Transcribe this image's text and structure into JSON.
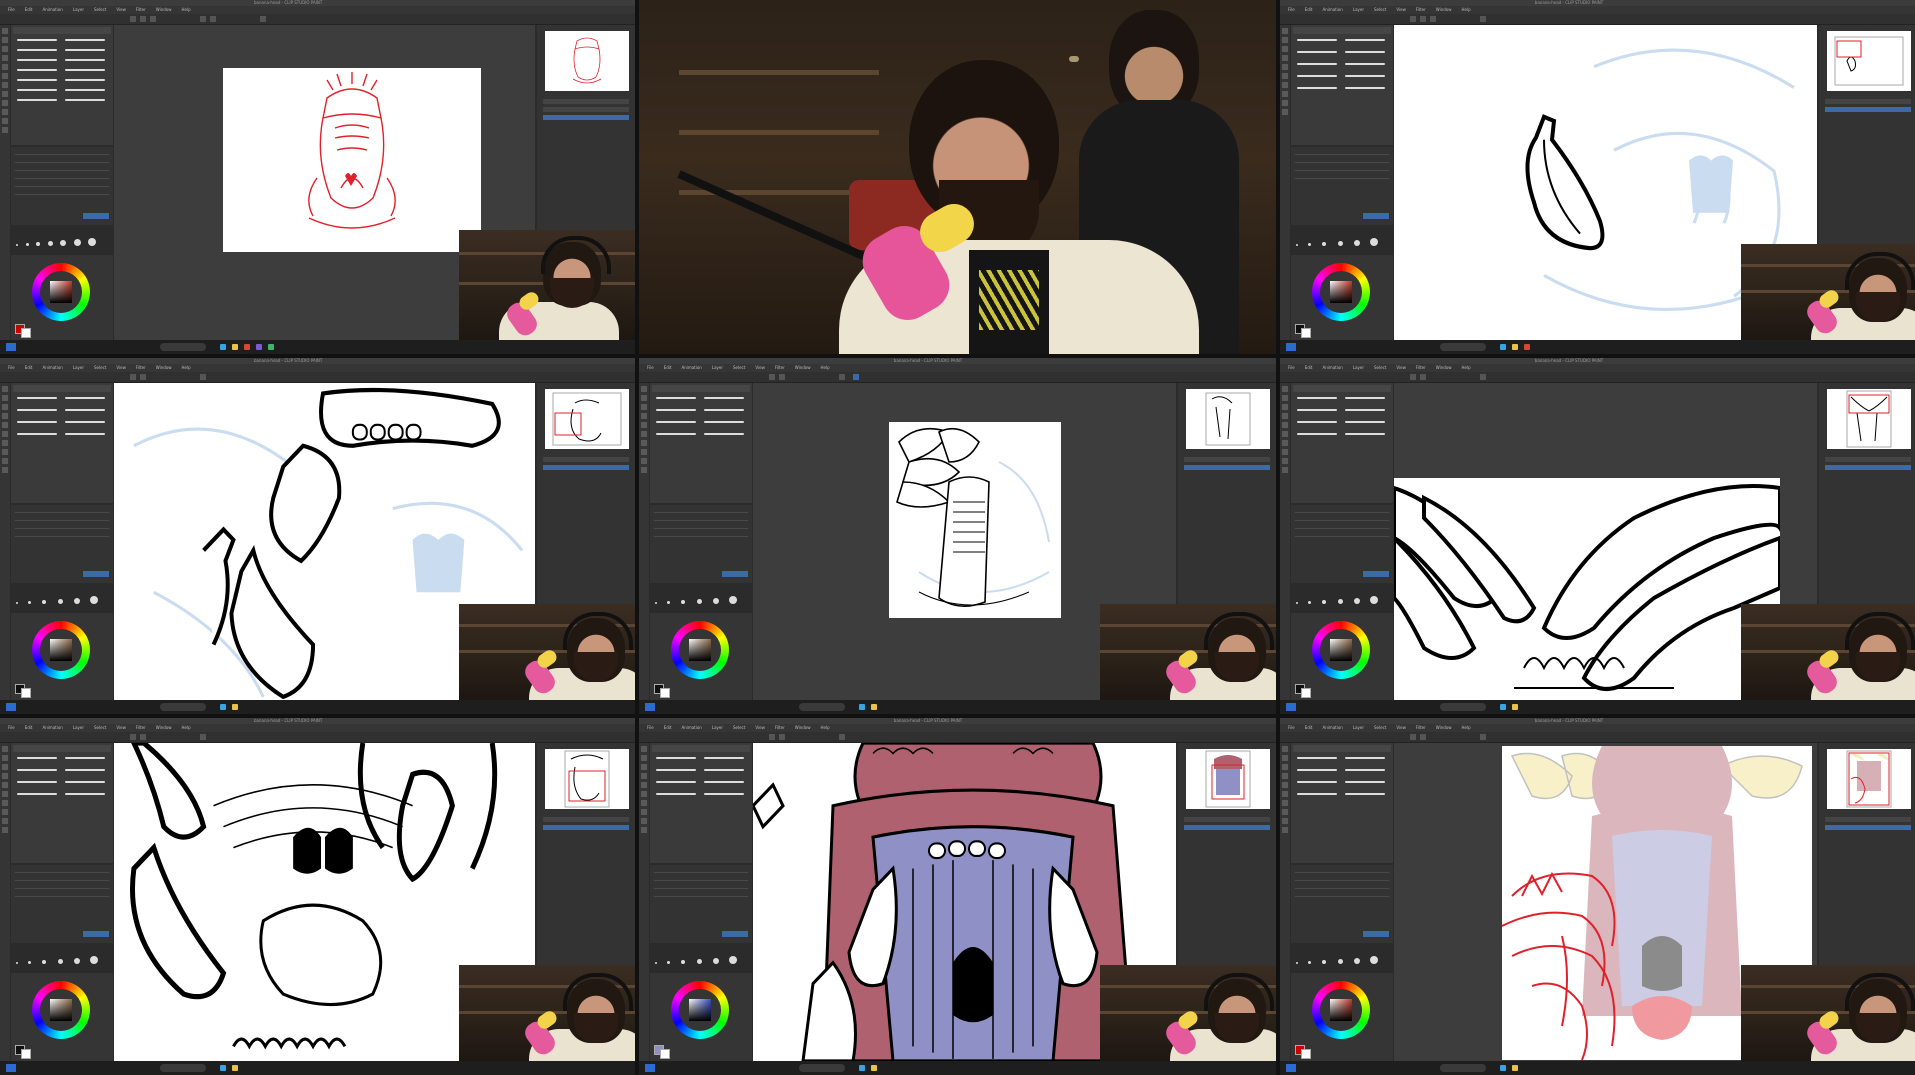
{
  "page": {
    "layout": "3x3 timelapse grid of a drawing stream"
  },
  "app": {
    "title": "banana-head - CLIP STUDIO PAINT",
    "menu": [
      "File",
      "Edit",
      "Animation",
      "Layer",
      "Select",
      "View",
      "Filter",
      "Window",
      "Help"
    ]
  },
  "panels": [
    {
      "id": "p1",
      "type": "app",
      "canvas_desc": "red sketch, full view",
      "wheel_square": "#c0392b"
    },
    {
      "id": "p2",
      "type": "camera"
    },
    {
      "id": "p3",
      "type": "app",
      "canvas_desc": "single banana inked",
      "wheel_square": "#c0392b"
    },
    {
      "id": "p4",
      "type": "app",
      "canvas_desc": "bananas around mouth inked",
      "wheel_square": "#8a6a4a"
    },
    {
      "id": "p5",
      "type": "app",
      "canvas_desc": "inked figure full view",
      "wheel_square": "#8a6a4a"
    },
    {
      "id": "p6",
      "type": "app",
      "canvas_desc": "banana crown inked",
      "wheel_square": "#8a6a4a"
    },
    {
      "id": "p7",
      "type": "app",
      "canvas_desc": "face details inked",
      "wheel_square": "#8a6a4a"
    },
    {
      "id": "p8",
      "type": "app",
      "canvas_desc": "flat colors mauve and lavender",
      "wheel_square": "#3b4fc4"
    },
    {
      "id": "p9",
      "type": "app",
      "canvas_desc": "faded color with red sketch overlay",
      "wheel_square": "#c0392b"
    }
  ],
  "colors": {
    "sketch_red": "#e0202a",
    "ink": "#000000",
    "blue_sketch": "#c9dcf0",
    "mauve": "#b0616f",
    "lavender": "#8f91c6",
    "banana_yellow": "#efe08a"
  }
}
